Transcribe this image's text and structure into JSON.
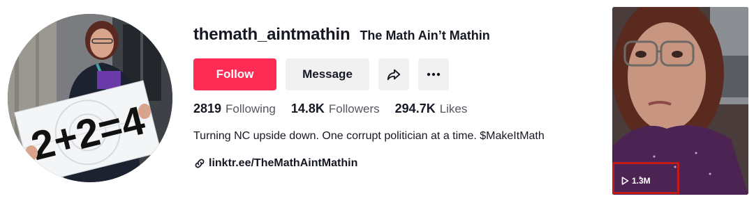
{
  "profile": {
    "username": "themath_aintmathin",
    "display_name": "The Math Ain’t Mathin",
    "avatar_sign_text": "2+2=4"
  },
  "buttons": {
    "follow": "Follow",
    "message": "Message",
    "share_icon": "share-arrow-icon",
    "more_icon": "more-dots-icon"
  },
  "stats": [
    {
      "value": "2819",
      "label": "Following"
    },
    {
      "value": "14.8K",
      "label": "Followers"
    },
    {
      "value": "294.7K",
      "label": "Likes"
    }
  ],
  "bio": "Turning NC upside down. One corrupt politician at a time. $MakeItMath",
  "link": {
    "icon": "link-icon",
    "text": "linktr.ee/TheMathAintMathin"
  },
  "video": {
    "views": "1.3M",
    "play_icon": "play-icon",
    "highlight_color": "#c21b17"
  },
  "colors": {
    "follow_bg": "#fe2c55",
    "secondary_bg": "#f1f1f2",
    "text": "#161823",
    "muted": "#55575f"
  }
}
